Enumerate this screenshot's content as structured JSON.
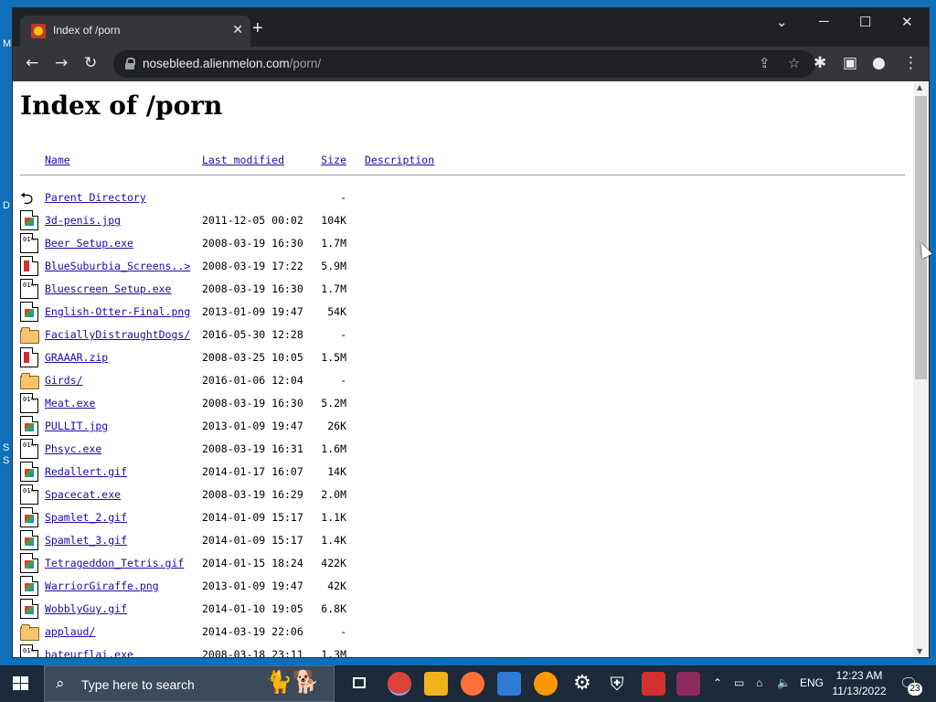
{
  "desktop": {
    "frag1": "M",
    "frag2": "D",
    "frag3": "S",
    "frag4": "S"
  },
  "browser": {
    "tab_title": "Index of /porn",
    "tab_close": "✕",
    "new_tab": "+",
    "win_min": "─",
    "win_max": "☐",
    "win_close": "✕",
    "win_menu": "⌄",
    "url_host": "nosebleed.alienmelon.com",
    "url_path": "/porn/"
  },
  "page": {
    "heading": "Index of /porn",
    "columns": {
      "name": "Name",
      "modified": "Last modified",
      "size": "Size",
      "description": "Description"
    },
    "rows": [
      {
        "name": "Parent Directory",
        "date": "",
        "size": "-",
        "icon": "back"
      },
      {
        "name": "3d-penis.jpg",
        "date": "2011-12-05 00:02",
        "size": "104K",
        "icon": "img"
      },
      {
        "name": "Beer Setup.exe",
        "date": "2008-03-19 16:30",
        "size": "1.7M",
        "icon": "bin"
      },
      {
        "name": "BlueSuburbia_Screens..>",
        "date": "2008-03-19 17:22",
        "size": "5.9M",
        "icon": "zip"
      },
      {
        "name": "Bluescreen Setup.exe",
        "date": "2008-03-19 16:30",
        "size": "1.7M",
        "icon": "bin"
      },
      {
        "name": "English-Otter-Final.png",
        "date": "2013-01-09 19:47",
        "size": "54K",
        "icon": "img"
      },
      {
        "name": "FaciallyDistraughtDogs/",
        "date": "2016-05-30 12:28",
        "size": "-",
        "icon": "folder"
      },
      {
        "name": "GRAAAR.zip",
        "date": "2008-03-25 10:05",
        "size": "1.5M",
        "icon": "zip"
      },
      {
        "name": "Girds/",
        "date": "2016-01-06 12:04",
        "size": "-",
        "icon": "folder"
      },
      {
        "name": "Meat.exe",
        "date": "2008-03-19 16:30",
        "size": "5.2M",
        "icon": "bin"
      },
      {
        "name": "PULLIT.jpg",
        "date": "2013-01-09 19:47",
        "size": "26K",
        "icon": "img"
      },
      {
        "name": "Phsyc.exe",
        "date": "2008-03-19 16:31",
        "size": "1.6M",
        "icon": "bin"
      },
      {
        "name": "Redallert.gif",
        "date": "2014-01-17 16:07",
        "size": "14K",
        "icon": "img"
      },
      {
        "name": "Spacecat.exe",
        "date": "2008-03-19 16:29",
        "size": "2.0M",
        "icon": "bin"
      },
      {
        "name": "Spamlet_2.gif",
        "date": "2014-01-09 15:17",
        "size": "1.1K",
        "icon": "img"
      },
      {
        "name": "Spamlet_3.gif",
        "date": "2014-01-09 15:17",
        "size": "1.4K",
        "icon": "img"
      },
      {
        "name": "Tetrageddon_Tetris.gif",
        "date": "2014-01-15 18:24",
        "size": "422K",
        "icon": "img"
      },
      {
        "name": "WarriorGiraffe.png",
        "date": "2013-01-09 19:47",
        "size": "42K",
        "icon": "img"
      },
      {
        "name": "WobblyGuy.gif",
        "date": "2014-01-10 19:05",
        "size": "6.8K",
        "icon": "img"
      },
      {
        "name": "applaud/",
        "date": "2014-03-19 22:06",
        "size": "-",
        "icon": "folder"
      },
      {
        "name": "bateurflai.exe",
        "date": "2008-03-18 23:11",
        "size": "1.3M",
        "icon": "bin"
      }
    ]
  },
  "taskbar": {
    "search_placeholder": "Type here to search",
    "lang": "ENG",
    "time": "12:23 AM",
    "date": "11/13/2022",
    "notifications": "23",
    "colors": {
      "chrome": "#db4437",
      "explorer": "#f2b21c",
      "firefox": "#ff7139",
      "virtualbox": "#2e7bd6",
      "sublime": "#ff9800",
      "winrar": "#8e2b5a"
    }
  }
}
